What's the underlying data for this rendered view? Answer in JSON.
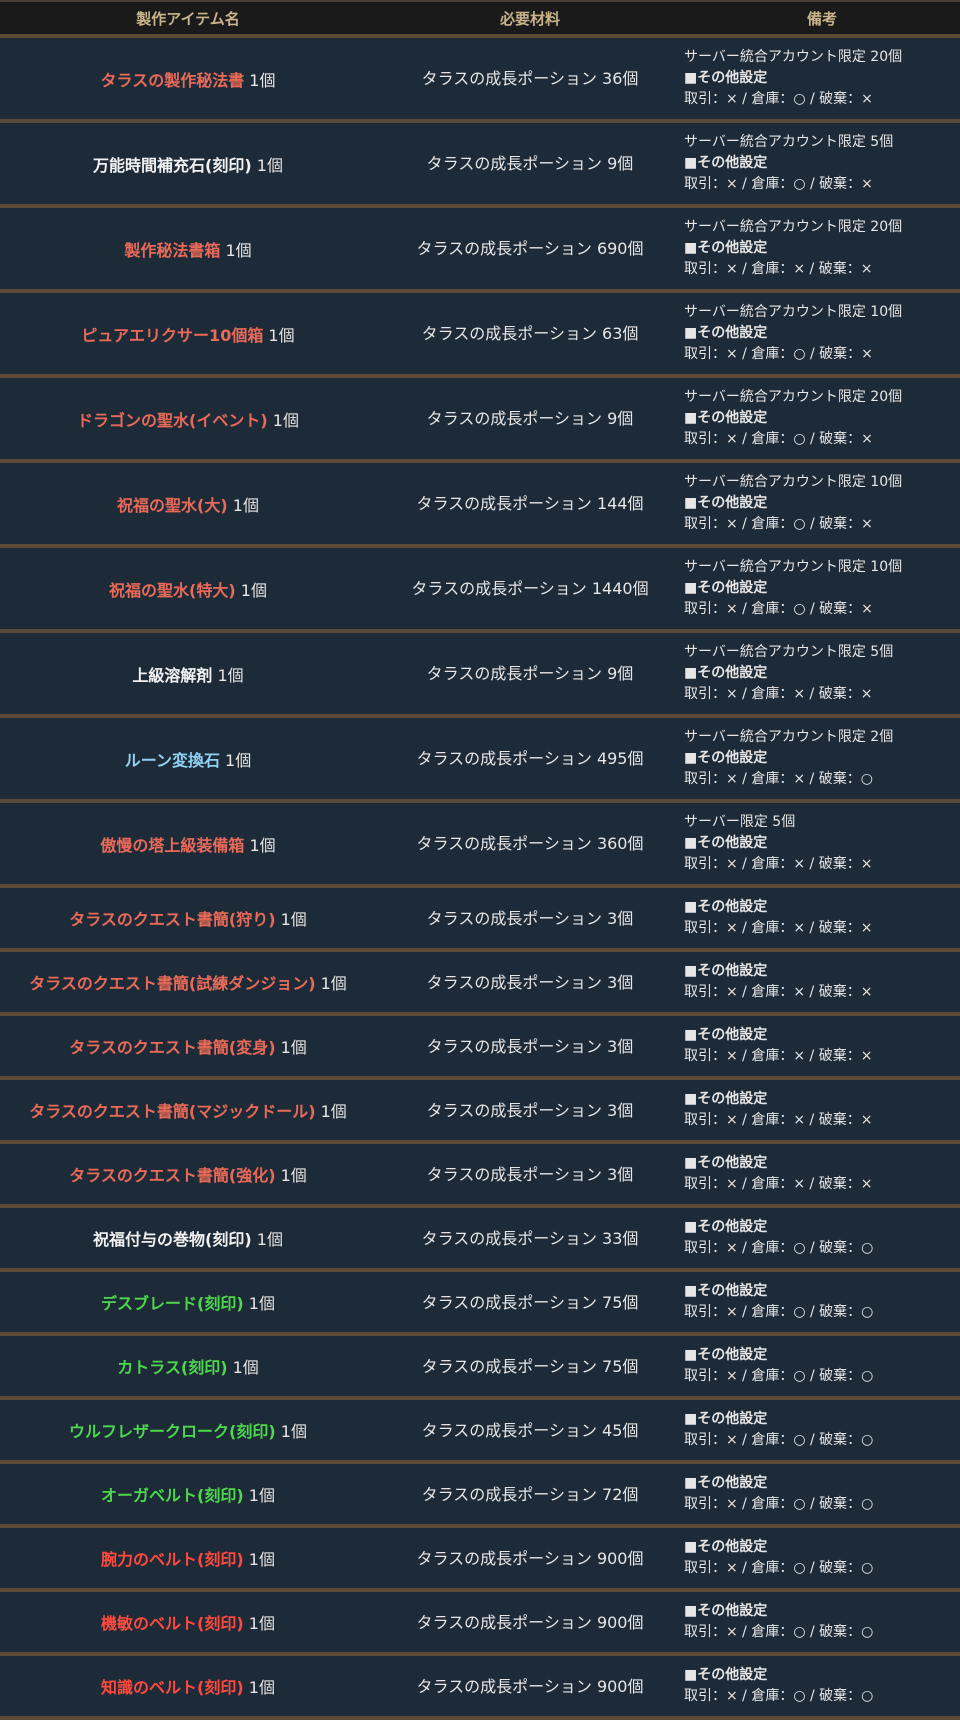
{
  "header": {
    "col_name": "製作アイテム名",
    "col_material": "必要材料",
    "col_note": "備考"
  },
  "rows": [
    {
      "name": "タラスの製作秘法書",
      "qty": "1個",
      "material": "タラスの成長ポーション 36個",
      "limit": "サーバー統合アカウント限定 20個",
      "settings_head": "■その他設定",
      "settings": "取引：× / 倉庫：○ / 破棄：×"
    },
    {
      "name": "万能時間補充石(刻印)",
      "qty": "1個",
      "material": "タラスの成長ポーション 9個",
      "limit": "サーバー統合アカウント限定 5個",
      "settings_head": "■その他設定",
      "settings": "取引：× / 倉庫：○ / 破棄：×"
    },
    {
      "name": "製作秘法書箱",
      "qty": "1個",
      "material": "タラスの成長ポーション 690個",
      "limit": "サーバー統合アカウント限定 20個",
      "settings_head": "■その他設定",
      "settings": "取引：× / 倉庫：× / 破棄：×"
    },
    {
      "name": "ピュアエリクサー10個箱",
      "qty": "1個",
      "material": "タラスの成長ポーション 63個",
      "limit": "サーバー統合アカウント限定 10個",
      "settings_head": "■その他設定",
      "settings": "取引：× / 倉庫：○ / 破棄：×"
    },
    {
      "name": "ドラゴンの聖水(イベント)",
      "qty": "1個",
      "material": "タラスの成長ポーション 9個",
      "limit": "サーバー統合アカウント限定 20個",
      "settings_head": "■その他設定",
      "settings": "取引：× / 倉庫：○ / 破棄：×"
    },
    {
      "name": "祝福の聖水(大)",
      "qty": "1個",
      "material": "タラスの成長ポーション 144個",
      "limit": "サーバー統合アカウント限定 10個",
      "settings_head": "■その他設定",
      "settings": "取引：× / 倉庫：○ / 破棄：×"
    },
    {
      "name": "祝福の聖水(特大)",
      "qty": "1個",
      "material": "タラスの成長ポーション 1440個",
      "limit": "サーバー統合アカウント限定 10個",
      "settings_head": "■その他設定",
      "settings": "取引：× / 倉庫：○ / 破棄：×"
    },
    {
      "name": "上級溶解剤",
      "qty": "1個",
      "material": "タラスの成長ポーション 9個",
      "limit": "サーバー統合アカウント限定 5個",
      "settings_head": "■その他設定",
      "settings": "取引：× / 倉庫：× / 破棄：×"
    },
    {
      "name": "ルーン変換石",
      "qty": "1個",
      "material": "タラスの成長ポーション 495個",
      "limit": "サーバー統合アカウント限定 2個",
      "settings_head": "■その他設定",
      "settings": "取引：× / 倉庫：× / 破棄：○"
    },
    {
      "name": "傲慢の塔上級装備箱",
      "qty": "1個",
      "material": "タラスの成長ポーション 360個",
      "limit": "サーバー限定 5個",
      "settings_head": "■その他設定",
      "settings": "取引：× / 倉庫：× / 破棄：×"
    },
    {
      "name": "タラスのクエスト書簡(狩り)",
      "qty": "1個",
      "material": "タラスの成長ポーション 3個",
      "limit": "",
      "settings_head": "■その他設定",
      "settings": "取引：× / 倉庫：× / 破棄：×"
    },
    {
      "name": "タラスのクエスト書簡(試練ダンジョン)",
      "qty": "1個",
      "material": "タラスの成長ポーション 3個",
      "limit": "",
      "settings_head": "■その他設定",
      "settings": "取引：× / 倉庫：× / 破棄：×"
    },
    {
      "name": "タラスのクエスト書簡(変身)",
      "qty": "1個",
      "material": "タラスの成長ポーション 3個",
      "limit": "",
      "settings_head": "■その他設定",
      "settings": "取引：× / 倉庫：× / 破棄：×"
    },
    {
      "name": "タラスのクエスト書簡(マジックドール)",
      "qty": "1個",
      "material": "タラスの成長ポーション 3個",
      "limit": "",
      "settings_head": "■その他設定",
      "settings": "取引：× / 倉庫：× / 破棄：×"
    },
    {
      "name": "タラスのクエスト書簡(強化)",
      "qty": "1個",
      "material": "タラスの成長ポーション 3個",
      "limit": "",
      "settings_head": "■その他設定",
      "settings": "取引：× / 倉庫：× / 破棄：×"
    },
    {
      "name": "祝福付与の巻物(刻印)",
      "qty": "1個",
      "material": "タラスの成長ポーション 33個",
      "limit": "",
      "settings_head": "■その他設定",
      "settings": "取引：× / 倉庫：○ / 破棄：○"
    },
    {
      "name": "デスブレード(刻印)",
      "qty": "1個",
      "material": "タラスの成長ポーション 75個",
      "limit": "",
      "settings_head": "■その他設定",
      "settings": "取引：× / 倉庫：○ / 破棄：○"
    },
    {
      "name": "カトラス(刻印)",
      "qty": "1個",
      "material": "タラスの成長ポーション 75個",
      "limit": "",
      "settings_head": "■その他設定",
      "settings": "取引：× / 倉庫：○ / 破棄：○"
    },
    {
      "name": "ウルフレザークローク(刻印)",
      "qty": "1個",
      "material": "タラスの成長ポーション 45個",
      "limit": "",
      "settings_head": "■その他設定",
      "settings": "取引：× / 倉庫：○ / 破棄：○"
    },
    {
      "name": "オーガベルト(刻印)",
      "qty": "1個",
      "material": "タラスの成長ポーション 72個",
      "limit": "",
      "settings_head": "■その他設定",
      "settings": "取引：× / 倉庫：○ / 破棄：○"
    },
    {
      "name": "腕力のベルト(刻印)",
      "qty": "1個",
      "material": "タラスの成長ポーション 900個",
      "limit": "",
      "settings_head": "■その他設定",
      "settings": "取引：× / 倉庫：○ / 破棄：○"
    },
    {
      "name": "機敏のベルト(刻印)",
      "qty": "1個",
      "material": "タラスの成長ポーション 900個",
      "limit": "",
      "settings_head": "■その他設定",
      "settings": "取引：× / 倉庫：○ / 破棄：○"
    },
    {
      "name": "知識のベルト(刻印)",
      "qty": "1個",
      "material": "タラスの成長ポーション 900個",
      "limit": "",
      "settings_head": "■その他設定",
      "settings": "取引：× / 倉庫：○ / 破棄：○"
    }
  ],
  "colors": {
    "red": "#ea6a59",
    "white": "#f2f2f2",
    "blue": "#8fd0f3",
    "green": "#4cd84c",
    "bright_red": "#ff4a3d"
  }
}
